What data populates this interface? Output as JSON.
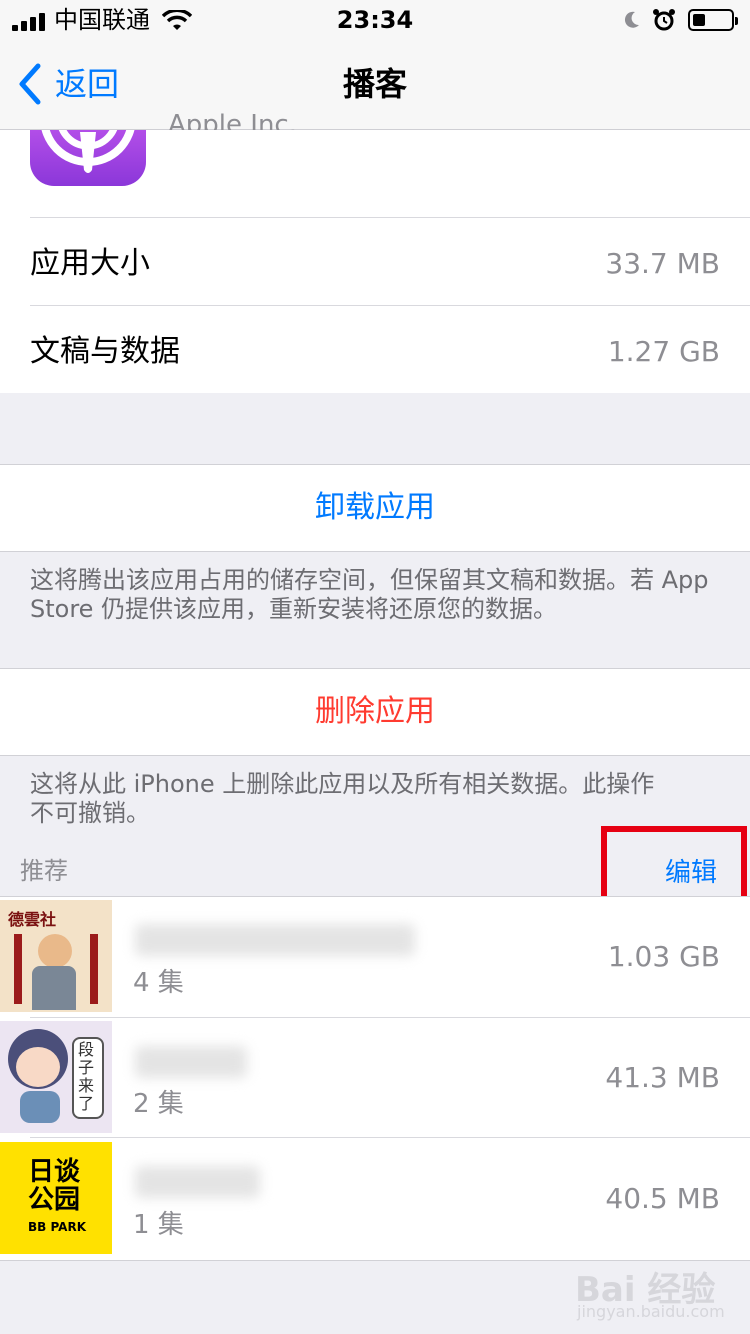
{
  "status_bar": {
    "carrier": "中国联通",
    "time": "23:34"
  },
  "nav": {
    "back_label": "返回",
    "title": "播客"
  },
  "app_info": {
    "developer": "Apple Inc.",
    "rows": [
      {
        "label": "应用大小",
        "value": "33.7 MB"
      },
      {
        "label": "文稿与数据",
        "value": "1.27 GB"
      }
    ]
  },
  "offload": {
    "label": "卸载应用",
    "note_line1": "这将腾出该应用占用的储存空间，但保留其文稿和数据。若 App",
    "note_line2": "Store 仍提供该应用，重新安装将还原您的数据。",
    "color": "#007aff"
  },
  "delete": {
    "label": "删除应用",
    "note_line1": "这将从此 iPhone 上删除此应用以及所有相关数据。此操作",
    "note_line2": "不可撤销。",
    "color": "#ff3b30"
  },
  "recommended": {
    "header": "推荐",
    "edit_label": "编辑",
    "items": [
      {
        "episodes": "4 集",
        "size": "1.03 GB",
        "thumb_text": "德雲社"
      },
      {
        "episodes": "2 集",
        "size": "41.3 MB",
        "thumb_text": "段子来了"
      },
      {
        "episodes": "1 集",
        "size": "40.5 MB",
        "thumb_text_1": "日谈",
        "thumb_text_2": "公园",
        "thumb_text_3": "BB PARK"
      }
    ]
  },
  "watermark": {
    "brand": "Bai 经验",
    "url": "jingyan.baidu.com"
  }
}
